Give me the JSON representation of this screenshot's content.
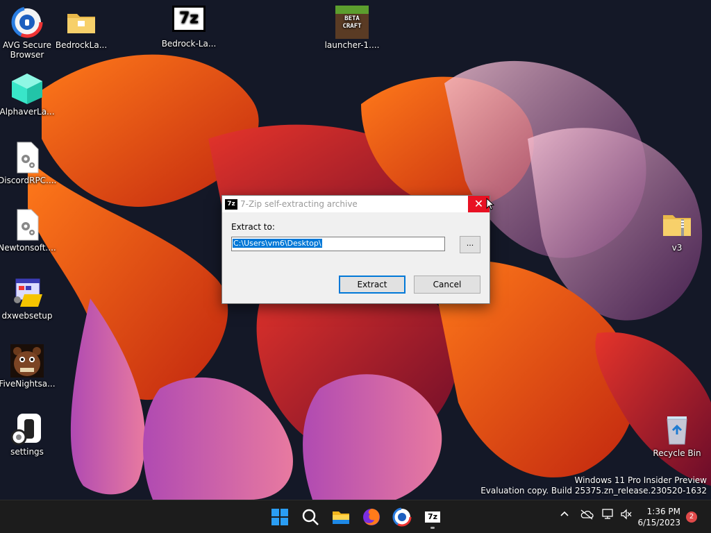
{
  "desktop": {
    "icons": [
      {
        "label": "AVG Secure\nBrowser"
      },
      {
        "label": "BedrockLa..."
      },
      {
        "label": "Bedrock-La..."
      },
      {
        "label": "launcher-1...."
      },
      {
        "label": "AlphaverLa..."
      },
      {
        "label": "DiscordRPC...."
      },
      {
        "label": "Newtonsoft...."
      },
      {
        "label": "dxwebsetup"
      },
      {
        "label": "FiveNightsa..."
      },
      {
        "label": "settings"
      },
      {
        "label": "v3"
      },
      {
        "label": "Recycle Bin"
      }
    ],
    "beta_craft_text": "BETA\nCRAFT",
    "sevenzip_logo_text": "7z"
  },
  "dialog": {
    "title": "7-Zip self-extracting archive",
    "icon_text": "7z",
    "close_glyph": "✕",
    "extract_label": "Extract to:",
    "path_value": "C:\\Users\\vm6\\Desktop\\",
    "browse_label": "...",
    "extract_button": "Extract",
    "cancel_button": "Cancel"
  },
  "watermark": {
    "line1": "Windows 11 Pro Insider Preview",
    "line2": "Evaluation copy. Build 25375.zn_release.230520-1632"
  },
  "taskbar": {
    "time": "1:36 PM",
    "date": "6/15/2023",
    "notification_count": "2",
    "sevenzip_text": "7z"
  },
  "colors": {
    "accent": "#0078d7",
    "close_red": "#e81123",
    "taskbar_bg": "#1c1c1c"
  }
}
